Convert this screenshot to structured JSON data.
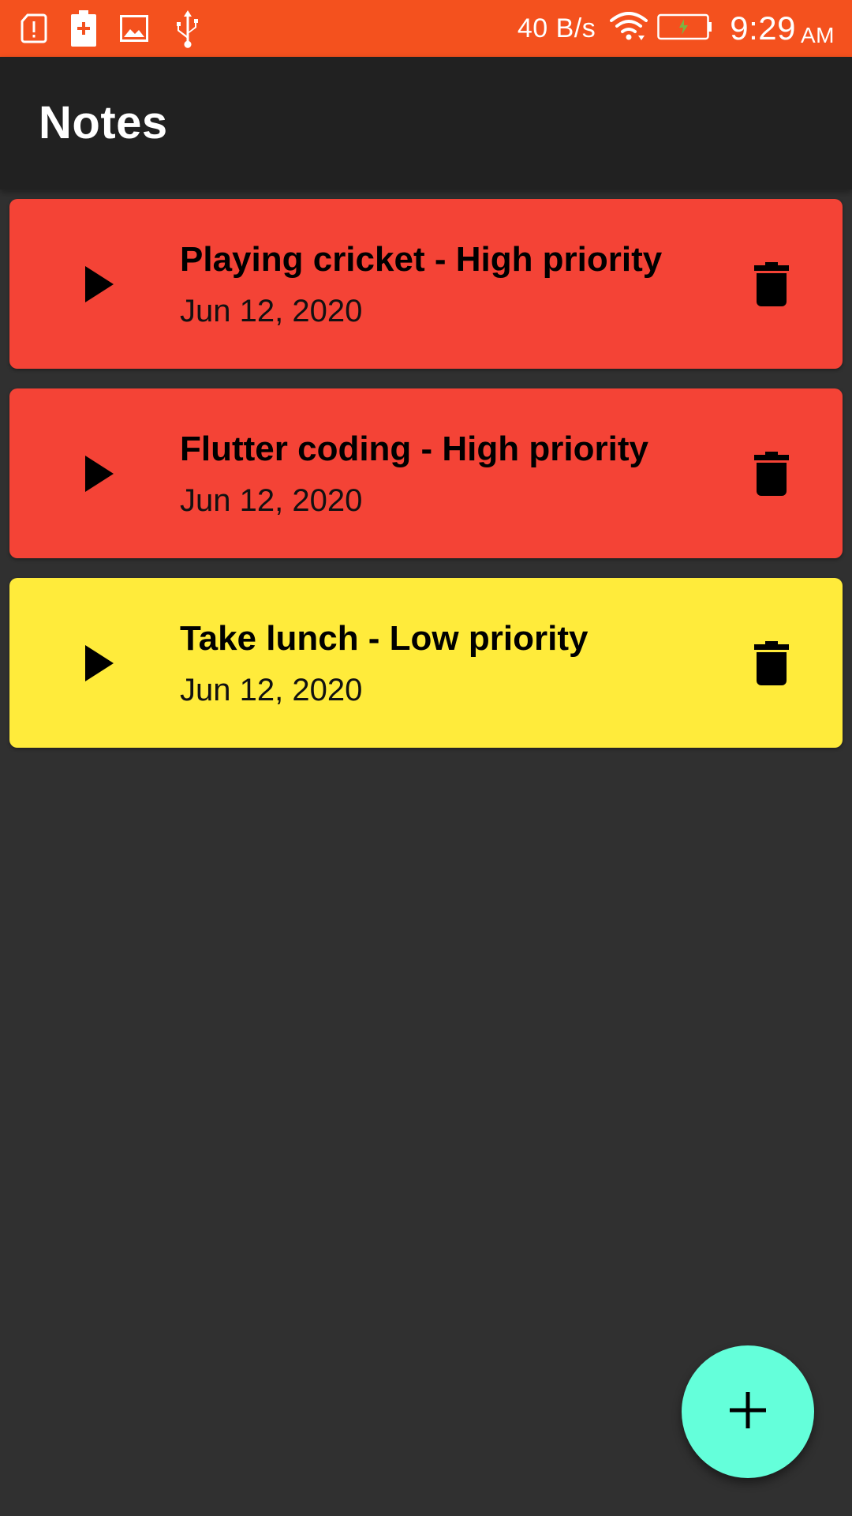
{
  "status_bar": {
    "icons_left": [
      "sim-alert-icon",
      "battery-saver-icon",
      "image-icon",
      "usb-icon"
    ],
    "net_speed": "40 B/s",
    "wifi_icon": "wifi-icon",
    "battery_icon": "battery-charging-icon",
    "time": "9:29",
    "ampm": "AM",
    "color": "#f4511e"
  },
  "app_bar": {
    "title": "Notes",
    "color": "#212121"
  },
  "notes": [
    {
      "title": "Playing cricket - High priority",
      "date": "Jun 12, 2020",
      "color": "#f44336",
      "leading_icon": "play-arrow-icon",
      "trailing_icon": "delete-icon"
    },
    {
      "title": "Flutter coding - High priority",
      "date": "Jun 12, 2020",
      "color": "#f44336",
      "leading_icon": "play-arrow-icon",
      "trailing_icon": "delete-icon"
    },
    {
      "title": "Take lunch - Low priority",
      "date": "Jun 12, 2020",
      "color": "#ffeb3b",
      "leading_icon": "play-arrow-icon",
      "trailing_icon": "delete-icon"
    }
  ],
  "fab": {
    "icon": "add-icon",
    "color": "#64ffda"
  },
  "background_color": "#303030"
}
